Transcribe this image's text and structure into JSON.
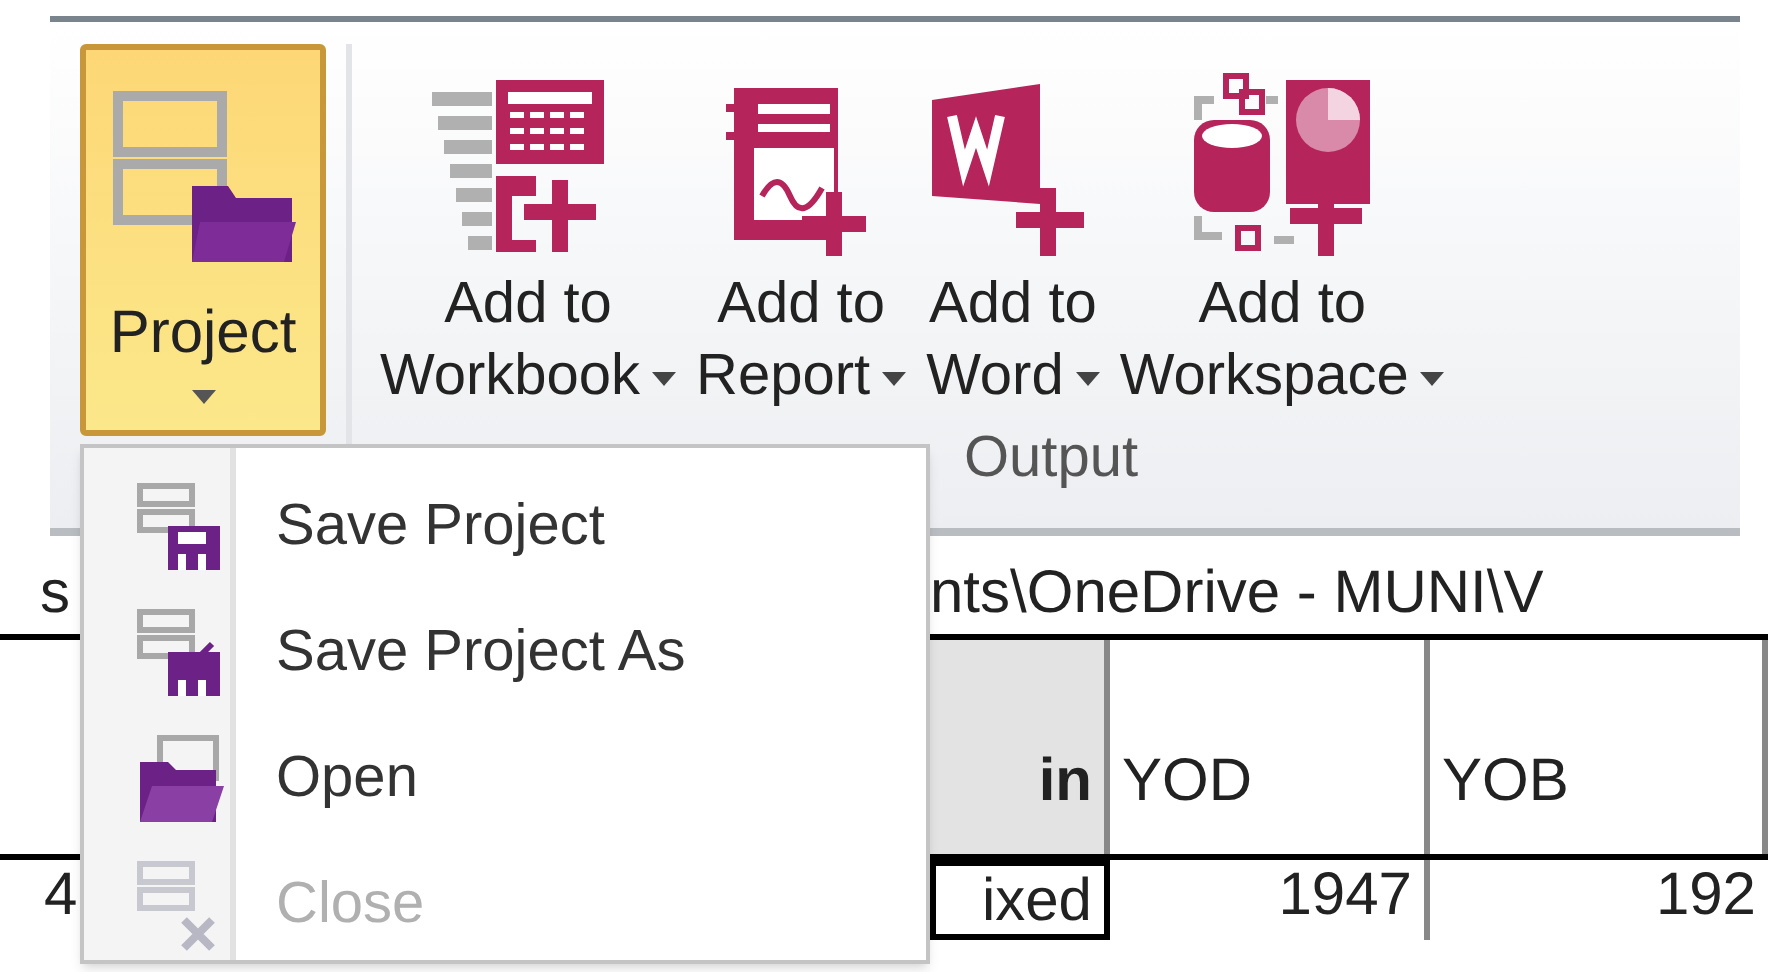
{
  "ribbon": {
    "project_button": {
      "label": "Project",
      "selected": true
    },
    "buttons": [
      {
        "line1": "Add to",
        "line2": "Workbook",
        "kind": "workbook"
      },
      {
        "line1": "Add to",
        "line2": "Report",
        "kind": "report"
      },
      {
        "line1": "Add to",
        "line2": "Word",
        "kind": "word"
      },
      {
        "line1": "Add to",
        "line2": "Workspace",
        "kind": "workspace"
      }
    ],
    "group_label": "Output"
  },
  "project_menu": {
    "items": [
      {
        "label": "Save Project",
        "kind": "save",
        "disabled": false
      },
      {
        "label": "Save Project As",
        "kind": "save_as",
        "disabled": false
      },
      {
        "label": "Open",
        "kind": "open",
        "disabled": false
      },
      {
        "label": "Close",
        "kind": "close",
        "disabled": true
      }
    ]
  },
  "path_bar": {
    "left_fragment": "s",
    "path": "nts\\OneDrive - MUNI\\V"
  },
  "table": {
    "columns": [
      "in",
      "YOD",
      "YOB"
    ],
    "rows": [
      {
        "row_header": "4",
        "cells": [
          "ixed",
          "1947",
          "192"
        ]
      }
    ]
  }
}
